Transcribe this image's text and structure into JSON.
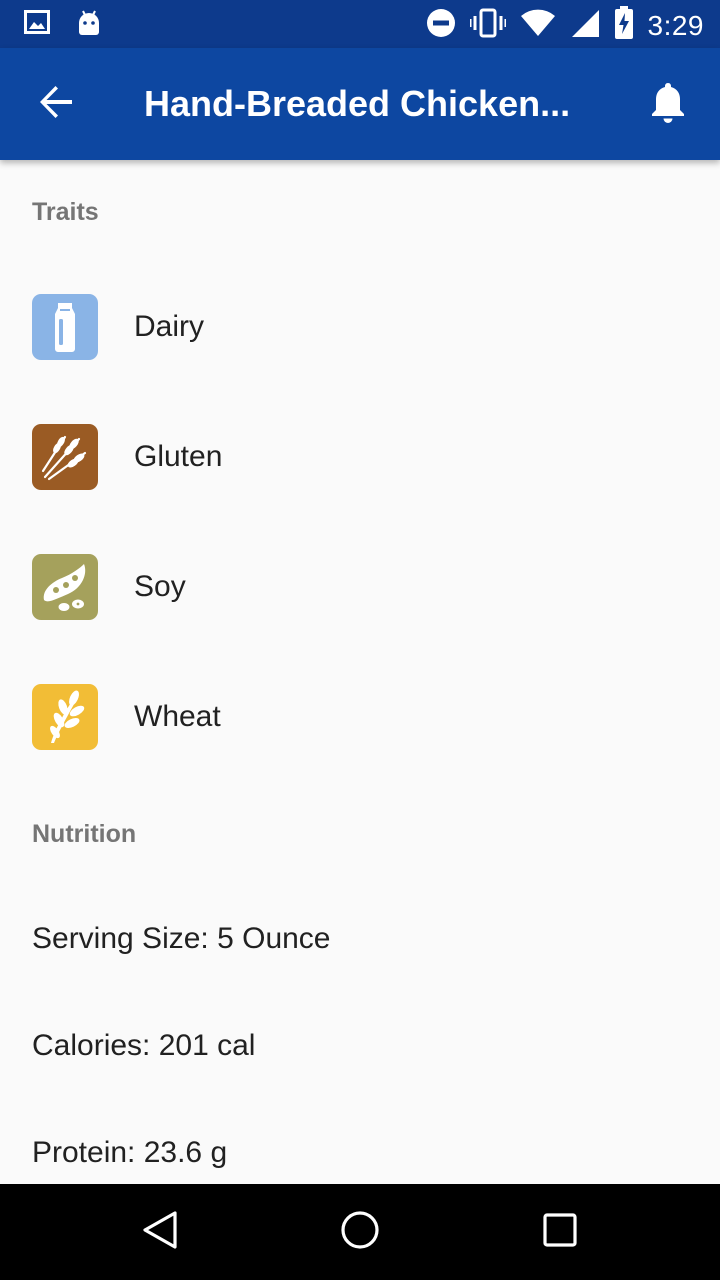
{
  "status_bar": {
    "time": "3:29",
    "icons": [
      "image-notification-icon",
      "android-notification-icon",
      "do-not-disturb-icon",
      "vibrate-icon",
      "wifi-icon",
      "cell-signal-icon",
      "battery-charging-icon"
    ]
  },
  "app_bar": {
    "title": "Hand-Breaded Chicken...",
    "back_icon": "arrow-back-icon",
    "bell_icon": "bell-icon"
  },
  "traits": {
    "header": "Traits",
    "items": [
      {
        "label": "Dairy",
        "icon": "milk-bottle-icon",
        "color": "#8ab4e6"
      },
      {
        "label": "Gluten",
        "icon": "grain-stalks-icon",
        "color": "#9a5b24"
      },
      {
        "label": "Soy",
        "icon": "soybean-icon",
        "color": "#a5a15c"
      },
      {
        "label": "Wheat",
        "icon": "wheat-icon",
        "color": "#f2bd36"
      }
    ]
  },
  "nutrition": {
    "header": "Nutrition",
    "rows": [
      {
        "text": "Serving Size: 5 Ounce"
      },
      {
        "text": "Calories: 201 cal"
      },
      {
        "text": "Protein: 23.6 g"
      }
    ]
  },
  "nav_bar": {
    "icons": [
      "back-triangle-icon",
      "home-circle-icon",
      "recents-square-icon"
    ]
  },
  "colors": {
    "status_bar": "#0d3a8c",
    "app_bar": "#0d47a1",
    "background": "#fafafa",
    "section_header": "#757575",
    "text": "#212121"
  }
}
